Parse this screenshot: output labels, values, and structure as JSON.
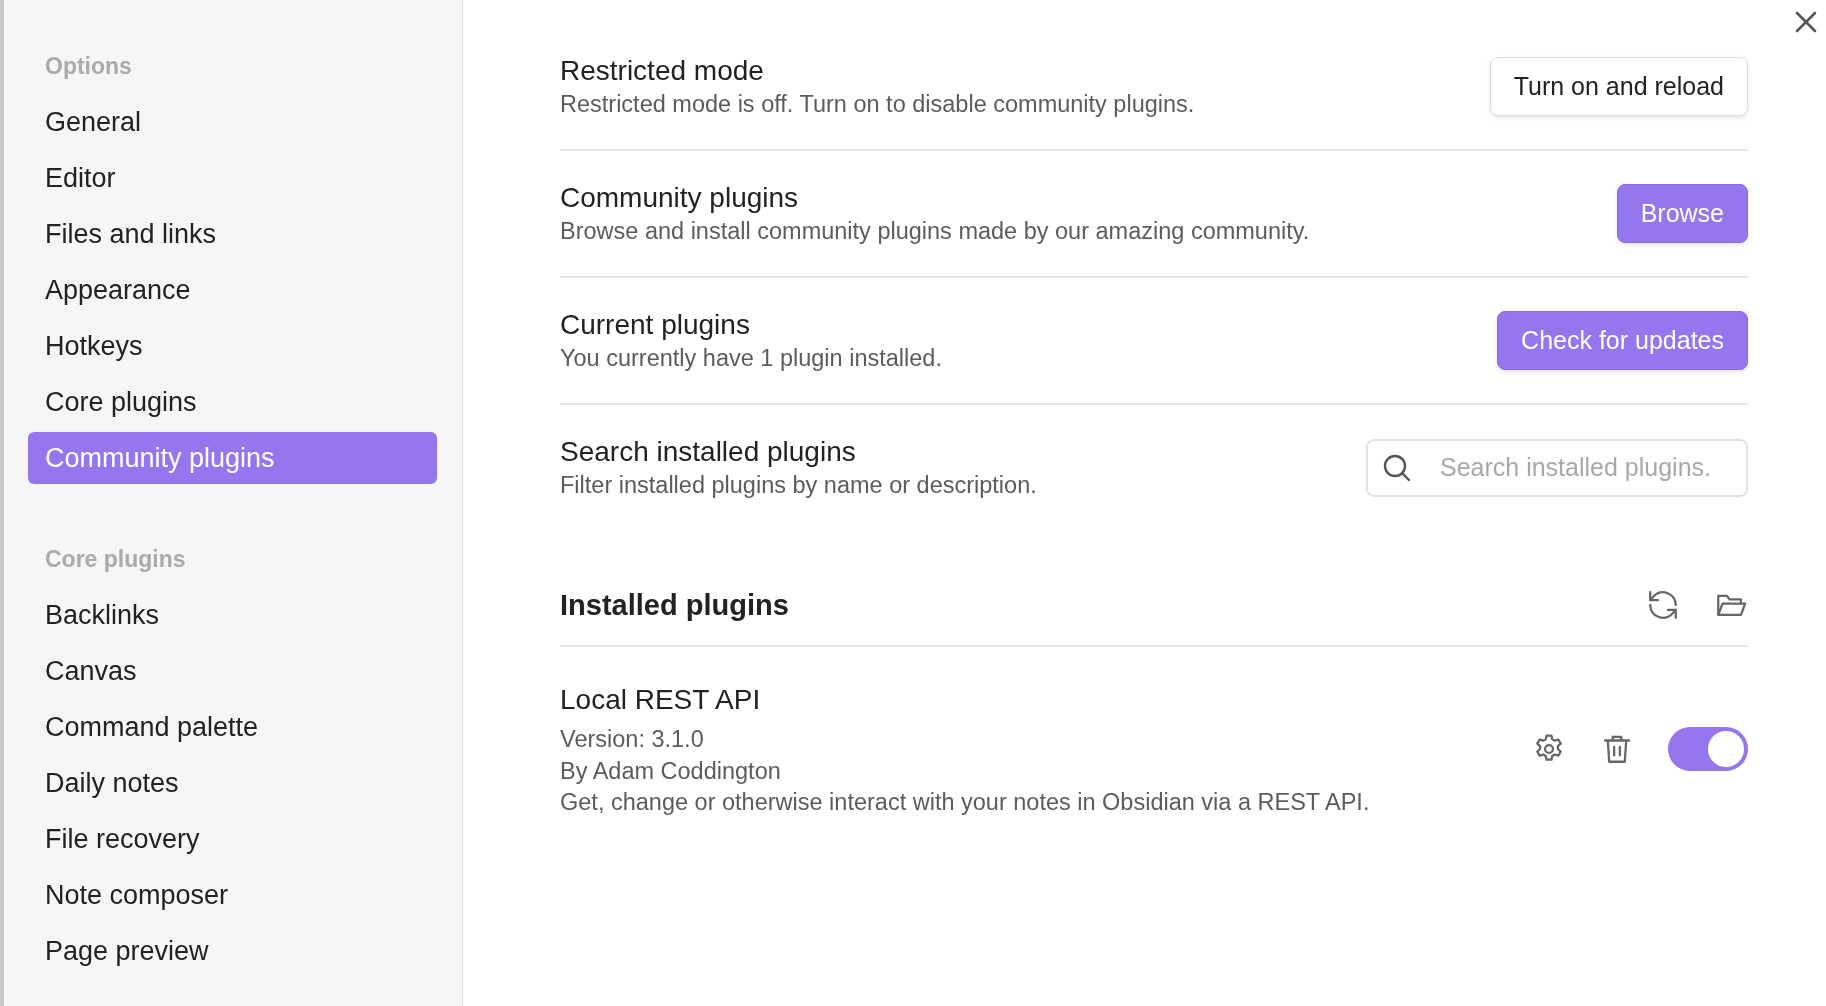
{
  "sidebar": {
    "sections": [
      {
        "heading": "Options",
        "items": [
          {
            "label": "General",
            "selected": false
          },
          {
            "label": "Editor",
            "selected": false
          },
          {
            "label": "Files and links",
            "selected": false
          },
          {
            "label": "Appearance",
            "selected": false
          },
          {
            "label": "Hotkeys",
            "selected": false
          },
          {
            "label": "Core plugins",
            "selected": false
          },
          {
            "label": "Community plugins",
            "selected": true
          }
        ]
      },
      {
        "heading": "Core plugins",
        "items": [
          {
            "label": "Backlinks",
            "selected": false
          },
          {
            "label": "Canvas",
            "selected": false
          },
          {
            "label": "Command palette",
            "selected": false
          },
          {
            "label": "Daily notes",
            "selected": false
          },
          {
            "label": "File recovery",
            "selected": false
          },
          {
            "label": "Note composer",
            "selected": false
          },
          {
            "label": "Page preview",
            "selected": false
          }
        ]
      }
    ]
  },
  "settings": [
    {
      "kind": "button",
      "title": "Restricted mode",
      "description": "Restricted mode is off. Turn on to disable community plugins.",
      "button": {
        "label": "Turn on and reload",
        "primary": false
      }
    },
    {
      "kind": "button",
      "title": "Community plugins",
      "description": "Browse and install community plugins made by our amazing community.",
      "button": {
        "label": "Browse",
        "primary": true
      }
    },
    {
      "kind": "button",
      "title": "Current plugins",
      "description": "You currently have 1 plugin installed.",
      "button": {
        "label": "Check for updates",
        "primary": true
      }
    },
    {
      "kind": "search",
      "title": "Search installed plugins",
      "description": "Filter installed plugins by name or description.",
      "placeholder": "Search installed plugins."
    }
  ],
  "installed": {
    "heading": "Installed plugins",
    "plugins": [
      {
        "name": "Local REST API",
        "version": "Version: 3.1.0",
        "author": "By Adam Coddington",
        "description": "Get, change or otherwise interact with your notes in Obsidian via a REST API.",
        "on": true
      }
    ]
  }
}
